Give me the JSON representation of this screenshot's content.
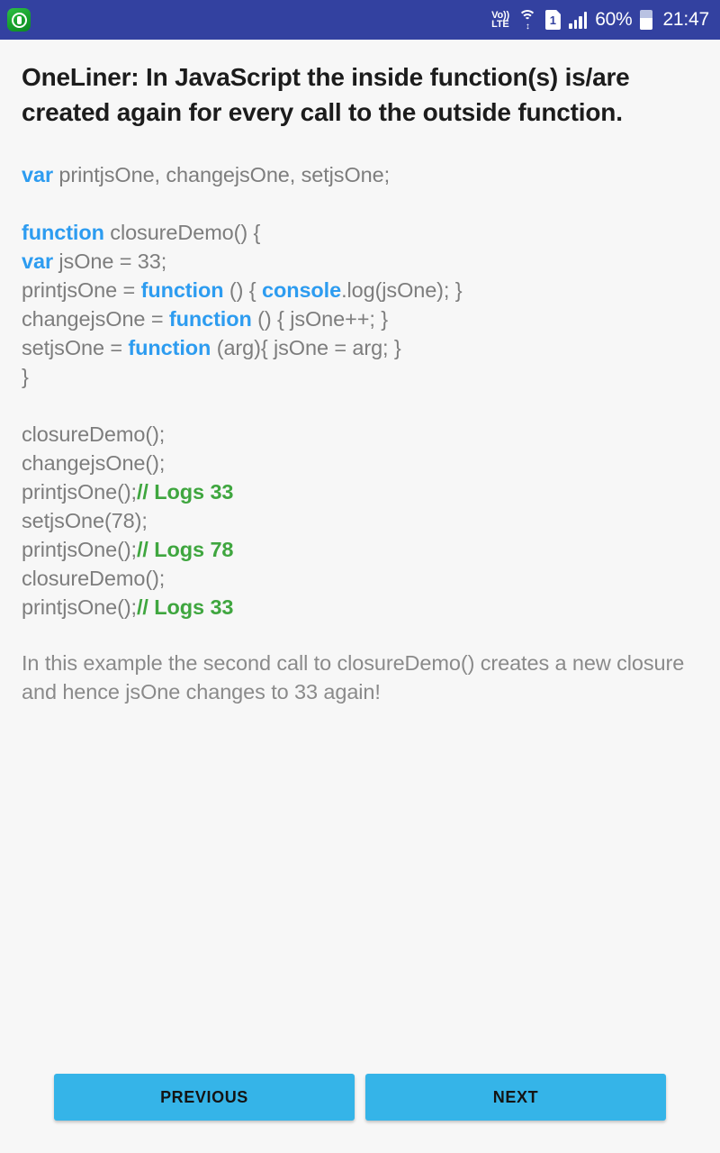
{
  "statusbar": {
    "app_icon": "app-logo-icon",
    "volte_line1": "Vo))",
    "volte_line2": "LTE",
    "wifi_icon": "wifi-icon",
    "wifi_arrows": "↕",
    "sim_label": "1",
    "signal_icon": "signal-bars-icon",
    "battery_percent": "60%",
    "battery_icon": "battery-icon",
    "clock": "21:47",
    "bar_color": "#3341a0"
  },
  "lesson": {
    "title": "OneLiner: In JavaScript the inside function(s) is/are created again for every call to the outside function.",
    "code_lines": [
      {
        "segments": [
          {
            "t": "var",
            "c": "kw"
          },
          {
            "t": " printjsOne, changejsOne, setjsOne;",
            "c": "plain"
          }
        ]
      },
      {
        "blank": true
      },
      {
        "segments": [
          {
            "t": "function",
            "c": "kw"
          },
          {
            "t": " closureDemo() {",
            "c": "plain"
          }
        ]
      },
      {
        "segments": [
          {
            "t": "var",
            "c": "kw"
          },
          {
            "t": " jsOne = 33;",
            "c": "plain"
          }
        ]
      },
      {
        "segments": [
          {
            "t": "printjsOne = ",
            "c": "plain"
          },
          {
            "t": "function",
            "c": "kw"
          },
          {
            "t": " () { ",
            "c": "plain"
          },
          {
            "t": "console",
            "c": "kw"
          },
          {
            "t": ".log(jsOne); }",
            "c": "plain"
          }
        ]
      },
      {
        "segments": [
          {
            "t": "changejsOne = ",
            "c": "plain"
          },
          {
            "t": "function",
            "c": "kw"
          },
          {
            "t": " () { jsOne++; }",
            "c": "plain"
          }
        ]
      },
      {
        "segments": [
          {
            "t": "setjsOne = ",
            "c": "plain"
          },
          {
            "t": "function",
            "c": "kw"
          },
          {
            "t": " (arg){ jsOne = arg; }",
            "c": "plain"
          }
        ]
      },
      {
        "segments": [
          {
            "t": "}",
            "c": "plain"
          }
        ]
      },
      {
        "blank": true
      },
      {
        "segments": [
          {
            "t": "closureDemo();",
            "c": "plain"
          }
        ]
      },
      {
        "segments": [
          {
            "t": "changejsOne();",
            "c": "plain"
          }
        ]
      },
      {
        "segments": [
          {
            "t": "printjsOne();",
            "c": "plain"
          },
          {
            "t": "// Logs 33",
            "c": "cmt"
          }
        ]
      },
      {
        "segments": [
          {
            "t": "setjsOne(78);",
            "c": "plain"
          }
        ]
      },
      {
        "segments": [
          {
            "t": "printjsOne();",
            "c": "plain"
          },
          {
            "t": "// Logs 78",
            "c": "cmt"
          }
        ]
      },
      {
        "segments": [
          {
            "t": "closureDemo();",
            "c": "plain"
          }
        ]
      },
      {
        "segments": [
          {
            "t": "printjsOne();",
            "c": "plain"
          },
          {
            "t": "// Logs 33",
            "c": "cmt"
          }
        ]
      }
    ],
    "explanation": "In this example the second call to closureDemo() creates a new closure and hence jsOne changes to 33 again!"
  },
  "footer": {
    "previous_label": "PREVIOUS",
    "next_label": "NEXT",
    "button_color": "#35b4e8"
  },
  "colors": {
    "keyword": "#2d9cf0",
    "comment": "#3fa63f",
    "code_text": "#7d7d7d",
    "title": "#1c1c1c",
    "background": "#f7f7f7"
  }
}
